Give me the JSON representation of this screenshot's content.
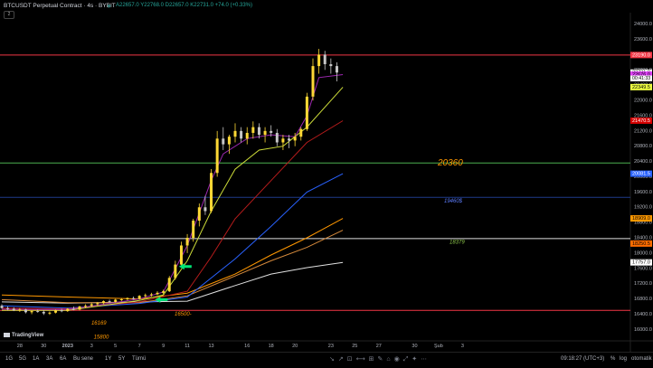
{
  "header": {
    "title": "BTCUSDT Perpetual Contract · 4s · BYBIT",
    "ohlc": "A22657.0 Y22768.0 D22657.0 K22731.0 +74.0 (+0.33%)",
    "collapse_label": "2"
  },
  "watermark": {
    "text": "TradingView"
  },
  "chart_data": {
    "type": "candlestick",
    "title": "BTCUSDT Perpetual Contract · 4s · BYBIT",
    "xlabel": "",
    "ylabel": "",
    "x_ticks": [
      {
        "label": "28",
        "t": 0
      },
      {
        "label": "30",
        "t": 2
      },
      {
        "label": "2023",
        "t": 4
      },
      {
        "label": "3",
        "t": 6
      },
      {
        "label": "5",
        "t": 8
      },
      {
        "label": "7",
        "t": 10
      },
      {
        "label": "9",
        "t": 12
      },
      {
        "label": "11",
        "t": 14
      },
      {
        "label": "13",
        "t": 16
      },
      {
        "label": "16",
        "t": 19
      },
      {
        "label": "18",
        "t": 21
      },
      {
        "label": "20",
        "t": 23
      },
      {
        "label": "23",
        "t": 26
      },
      {
        "label": "25",
        "t": 28
      },
      {
        "label": "27",
        "t": 30
      },
      {
        "label": "30",
        "t": 33
      },
      {
        "label": "Şub",
        "t": 35
      },
      {
        "label": "3",
        "t": 37
      }
    ],
    "xlim": [
      -1.5,
      37.5
    ],
    "ylim": [
      15700,
      24300
    ],
    "y_ticks": [
      16000,
      16400,
      16800,
      17200,
      17600,
      18000,
      18400,
      18800,
      19200,
      19600,
      20000,
      20400,
      20800,
      21200,
      21600,
      22000,
      22400,
      22800,
      23200,
      23600,
      24000
    ],
    "y_tick_labels": [
      "16000.0",
      "16400.0",
      "16800.0",
      "17200.0",
      "17600.0",
      "18000.0",
      "18400.0",
      "18800.0",
      "19200.0",
      "19600.0",
      "20000.0",
      "20400.0",
      "20800.0",
      "21200.0",
      "21600.0",
      "22000.0",
      "22400.0",
      "22800.0",
      "23200.0",
      "23600.0",
      "24000.0"
    ],
    "grid": false,
    "ohlc": [
      [
        -1.5,
        16620,
        16660,
        16540,
        16560
      ],
      [
        -1.0,
        16560,
        16600,
        16500,
        16540
      ],
      [
        -0.5,
        16540,
        16580,
        16480,
        16500
      ],
      [
        0.0,
        16500,
        16560,
        16460,
        16520
      ],
      [
        0.5,
        16520,
        16540,
        16420,
        16450
      ],
      [
        1.0,
        16450,
        16500,
        16400,
        16480
      ],
      [
        1.5,
        16480,
        16520,
        16440,
        16460
      ],
      [
        2.0,
        16460,
        16500,
        16380,
        16420
      ],
      [
        2.5,
        16420,
        16470,
        16380,
        16440
      ],
      [
        3.0,
        16440,
        16520,
        16420,
        16500
      ],
      [
        3.5,
        16500,
        16540,
        16450,
        16480
      ],
      [
        4.0,
        16480,
        16560,
        16460,
        16540
      ],
      [
        4.5,
        16540,
        16600,
        16500,
        16520
      ],
      [
        5.0,
        16520,
        16620,
        16500,
        16600
      ],
      [
        5.5,
        16600,
        16660,
        16560,
        16620
      ],
      [
        6.0,
        16620,
        16700,
        16600,
        16660
      ],
      [
        6.5,
        16660,
        16720,
        16620,
        16690
      ],
      [
        7.0,
        16690,
        16760,
        16660,
        16740
      ],
      [
        7.5,
        16740,
        16780,
        16700,
        16720
      ],
      [
        8.0,
        16720,
        16800,
        16700,
        16780
      ],
      [
        8.5,
        16780,
        16820,
        16740,
        16790
      ],
      [
        9.0,
        16790,
        16840,
        16760,
        16820
      ],
      [
        9.5,
        16820,
        16860,
        16780,
        16800
      ],
      [
        10.0,
        16800,
        16900,
        16780,
        16880
      ],
      [
        10.5,
        16880,
        16940,
        16840,
        16900
      ],
      [
        11.0,
        16900,
        16960,
        16860,
        16920
      ],
      [
        11.5,
        16920,
        17000,
        16900,
        16960
      ],
      [
        12.0,
        16960,
        17040,
        16920,
        17000
      ],
      [
        12.5,
        17000,
        17400,
        16980,
        17350
      ],
      [
        13.0,
        17350,
        17800,
        17300,
        17700
      ],
      [
        13.5,
        17700,
        18300,
        17650,
        18200
      ],
      [
        14.0,
        18200,
        18500,
        18000,
        18400
      ],
      [
        14.5,
        18400,
        18900,
        18300,
        18850
      ],
      [
        15.0,
        18850,
        19300,
        18700,
        19200
      ],
      [
        15.5,
        19200,
        19500,
        19000,
        19100
      ],
      [
        16.0,
        19100,
        20200,
        19050,
        20100
      ],
      [
        16.5,
        20100,
        21200,
        20000,
        21000
      ],
      [
        17.0,
        21000,
        21300,
        20700,
        20850
      ],
      [
        17.5,
        20850,
        21100,
        20600,
        21050
      ],
      [
        18.0,
        21050,
        21400,
        20900,
        21200
      ],
      [
        18.5,
        21200,
        21300,
        20900,
        21000
      ],
      [
        19.0,
        21000,
        21300,
        20850,
        21150
      ],
      [
        19.5,
        21150,
        21450,
        21000,
        21300
      ],
      [
        20.0,
        21300,
        21400,
        21000,
        21100
      ],
      [
        20.5,
        21100,
        21300,
        20900,
        21200
      ],
      [
        21.0,
        21200,
        21350,
        21050,
        21150
      ],
      [
        21.5,
        21150,
        21250,
        20800,
        20900
      ],
      [
        22.0,
        20900,
        21100,
        20700,
        21000
      ],
      [
        22.5,
        21000,
        21100,
        20750,
        20950
      ],
      [
        23.0,
        20950,
        21150,
        20800,
        21050
      ],
      [
        23.5,
        21050,
        21300,
        20950,
        21250
      ],
      [
        24.0,
        21250,
        22200,
        21200,
        22100
      ],
      [
        24.5,
        22100,
        23100,
        22000,
        22900
      ],
      [
        25.0,
        22900,
        23350,
        22700,
        23200
      ],
      [
        25.5,
        23200,
        23300,
        22800,
        22950
      ],
      [
        26.0,
        22950,
        23100,
        22700,
        22900
      ],
      [
        26.5,
        22900,
        23000,
        22500,
        22731
      ]
    ],
    "series": [
      {
        "name": "",
        "color": "#e0e0e0",
        "points": [
          [
            -1.5,
            16720
          ],
          [
            4,
            16690
          ],
          [
            10,
            16720
          ],
          [
            14,
            16740
          ],
          [
            18,
            17150
          ],
          [
            21,
            17450
          ],
          [
            24,
            17620
          ],
          [
            27,
            17757
          ]
        ]
      },
      {
        "name": "",
        "color": "#ff9800",
        "points": [
          [
            -1.5,
            16900
          ],
          [
            4,
            16850
          ],
          [
            10,
            16800
          ],
          [
            14,
            16950
          ],
          [
            18,
            17450
          ],
          [
            21,
            17950
          ],
          [
            24,
            18400
          ],
          [
            27,
            18909
          ]
        ]
      },
      {
        "name": "",
        "color": "#d68a3c",
        "points": [
          [
            -1.5,
            16780
          ],
          [
            4,
            16700
          ],
          [
            10,
            16700
          ],
          [
            14,
            16880
          ],
          [
            18,
            17400
          ],
          [
            21,
            17800
          ],
          [
            24,
            18150
          ],
          [
            27,
            18600
          ]
        ]
      },
      {
        "name": "",
        "color": "#2962ff",
        "points": [
          [
            -1.5,
            16620
          ],
          [
            4,
            16560
          ],
          [
            10,
            16680
          ],
          [
            14,
            16850
          ],
          [
            18,
            17850
          ],
          [
            21,
            18700
          ],
          [
            24,
            19600
          ],
          [
            27,
            20081
          ]
        ]
      },
      {
        "name": "",
        "color": "#b71c1c",
        "points": [
          [
            -1.5,
            16560
          ],
          [
            4,
            16540
          ],
          [
            10,
            16720
          ],
          [
            14,
            17000
          ],
          [
            16,
            17900
          ],
          [
            18,
            18900
          ],
          [
            21,
            19900
          ],
          [
            24,
            20900
          ],
          [
            27,
            21470
          ]
        ]
      },
      {
        "name": "",
        "color": "#cddc39",
        "points": [
          [
            -1.5,
            16500
          ],
          [
            4,
            16500
          ],
          [
            10,
            16760
          ],
          [
            12,
            16900
          ],
          [
            14,
            17800
          ],
          [
            16,
            19100
          ],
          [
            18,
            20200
          ],
          [
            20,
            20700
          ],
          [
            22,
            20800
          ],
          [
            24,
            21300
          ],
          [
            27,
            22349
          ]
        ]
      },
      {
        "name": "",
        "color": "#9c27b0",
        "points": [
          [
            -1.5,
            16530
          ],
          [
            4,
            16520
          ],
          [
            10,
            16800
          ],
          [
            12,
            16980
          ],
          [
            14,
            18200
          ],
          [
            16,
            19900
          ],
          [
            17,
            20600
          ],
          [
            19,
            21000
          ],
          [
            21,
            21100
          ],
          [
            23,
            21050
          ],
          [
            24,
            21600
          ],
          [
            25,
            22600
          ],
          [
            27,
            22676
          ]
        ]
      }
    ],
    "horizontal_levels": [
      {
        "value": 23190,
        "color": "#f23645",
        "label": "23190.0"
      },
      {
        "value": 20360,
        "color": "#4caf50",
        "label": "20360"
      },
      {
        "value": 19460,
        "color": "#1e3a8a",
        "label": "19460$"
      },
      {
        "value": 18379,
        "color": "#e0e0e0",
        "label": "18379"
      },
      {
        "value": 16500,
        "color": "#f23645",
        "label": "16500-"
      }
    ],
    "annotations": [
      {
        "text": "16169",
        "t": 2.2,
        "y": 16169,
        "color": "#ff9800"
      },
      {
        "text": "15800",
        "t": 2.4,
        "y": 15800,
        "color": "#ff9800"
      }
    ],
    "arrows": [
      {
        "t": 13.3,
        "y": 17650,
        "color": "#00e676"
      },
      {
        "t": 11.3,
        "y": 16780,
        "color": "#00e676"
      }
    ],
    "price_labels": [
      {
        "value": 23190,
        "text": "23190.0",
        "bg": "#f23645",
        "fg": "#ffffff"
      },
      {
        "value": 22731,
        "text": "22731.0",
        "bg": "#ffffff",
        "fg": "#000000"
      },
      {
        "value": 22676,
        "text": "22676.0",
        "bg": "#e040fb",
        "fg": "#000000"
      },
      {
        "value": 22349,
        "text": "22349.5",
        "bg": "#eeff41",
        "fg": "#000000"
      },
      {
        "value": 21470,
        "text": "21470.5",
        "bg": "#d50000",
        "fg": "#ffffff"
      },
      {
        "value": 20081,
        "text": "20081.5",
        "bg": "#2962ff",
        "fg": "#ffffff"
      },
      {
        "value": 18909,
        "text": "18909.0",
        "bg": "#ff9800",
        "fg": "#000000"
      },
      {
        "value": 18250,
        "text": "18250.5",
        "bg": "#ff6d00",
        "fg": "#000000"
      },
      {
        "value": 17757,
        "text": "17757.0",
        "bg": "#ffffff",
        "fg": "#000000"
      }
    ],
    "countdown": "00:41:33"
  },
  "bottom": {
    "timeframes": [
      "1G",
      "5G",
      "1A",
      "3A",
      "6A",
      "Bu sene",
      "1Y",
      "5Y",
      "Tümü"
    ],
    "clock": "09:18:27 (UTC+3)",
    "opt_percent": "%",
    "opt_log": "log",
    "opt_auto": "otomatik",
    "tools": "↘︎↗︎⊡⟷⊞✎⌂◉⤢✦⋯"
  },
  "colors": {
    "bull": "#fdd835",
    "bear": "#c6c6c6",
    "bg": "#000000"
  }
}
